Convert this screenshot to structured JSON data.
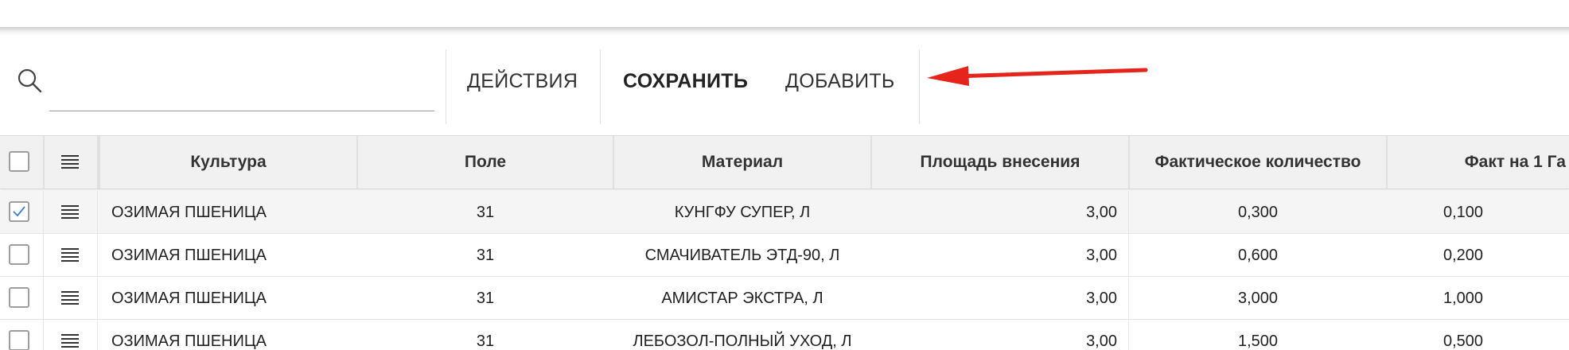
{
  "toolbar": {
    "search_placeholder": "",
    "search_value": "",
    "actions_label": "ДЕЙСТВИЯ",
    "save_label": "СОХРАНИТЬ",
    "add_label": "ДОБАВИТЬ"
  },
  "annotation": {
    "arrow_color": "#e5241b"
  },
  "table": {
    "columns": [
      "Культура",
      "Поле",
      "Материал",
      "Площадь внесения",
      "Фактическое количество",
      "Факт на 1 Га"
    ],
    "rows": [
      {
        "selected": true,
        "culture": "ОЗИМАЯ ПШЕНИЦА",
        "field": "31",
        "material": "КУНГФУ СУПЕР, Л",
        "area": "3,00",
        "actual_qty": "0,300",
        "per_ha": "0,100"
      },
      {
        "selected": false,
        "culture": "ОЗИМАЯ ПШЕНИЦА",
        "field": "31",
        "material": "СМАЧИВАТЕЛЬ ЭТД-90, Л",
        "area": "3,00",
        "actual_qty": "0,600",
        "per_ha": "0,200"
      },
      {
        "selected": false,
        "culture": "ОЗИМАЯ ПШЕНИЦА",
        "field": "31",
        "material": "АМИСТАР ЭКСТРА, Л",
        "area": "3,00",
        "actual_qty": "3,000",
        "per_ha": "1,000"
      },
      {
        "selected": false,
        "culture": "ОЗИМАЯ ПШЕНИЦА",
        "field": "31",
        "material": "ЛЕБОЗОЛ-ПОЛНЫЙ УХОД, Л",
        "area": "3,00",
        "actual_qty": "1,500",
        "per_ha": "0,500"
      }
    ]
  },
  "colors": {
    "check_blue": "#3b7fd6",
    "header_bg": "#f1f1f1"
  }
}
